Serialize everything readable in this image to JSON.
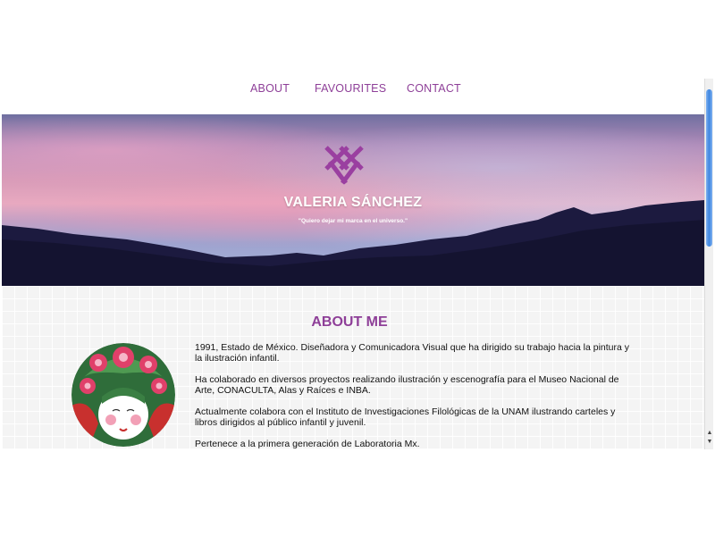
{
  "nav": {
    "about": "ABOUT",
    "favourites": "FAVOURITES",
    "contact": "CONTACT"
  },
  "hero": {
    "name": "VALERIA SÁNCHEZ",
    "quote": "\"Quiero dejar mi marca en el universo.\""
  },
  "about": {
    "title": "ABOUT ME",
    "paragraphs": [
      "1991, Estado de México. Diseñadora y Comunicadora Visual que ha dirigido su trabajo hacia la pintura y la ilustración infantil.",
      "Ha colaborado en diversos proyectos realizando ilustración y escenografía para el Museo Nacional de Arte, CONACULTA, Alas y Raíces e INBA.",
      "Actualmente colabora con el Instituto de Investigaciones Filológicas de la UNAM ilustrando carteles y libros dirigidos al público infantil y juvenil.",
      "Pertenece a la primera generación de Laboratoria Mx."
    ]
  },
  "icons": {
    "logo": "crossed-chevrons-logo",
    "portrait": "illustrated-girl-portrait",
    "scroll_up": "▲",
    "scroll_down": "▼"
  },
  "colors": {
    "accent": "#8e3f98",
    "scroll_thumb": "#3d86e0"
  }
}
